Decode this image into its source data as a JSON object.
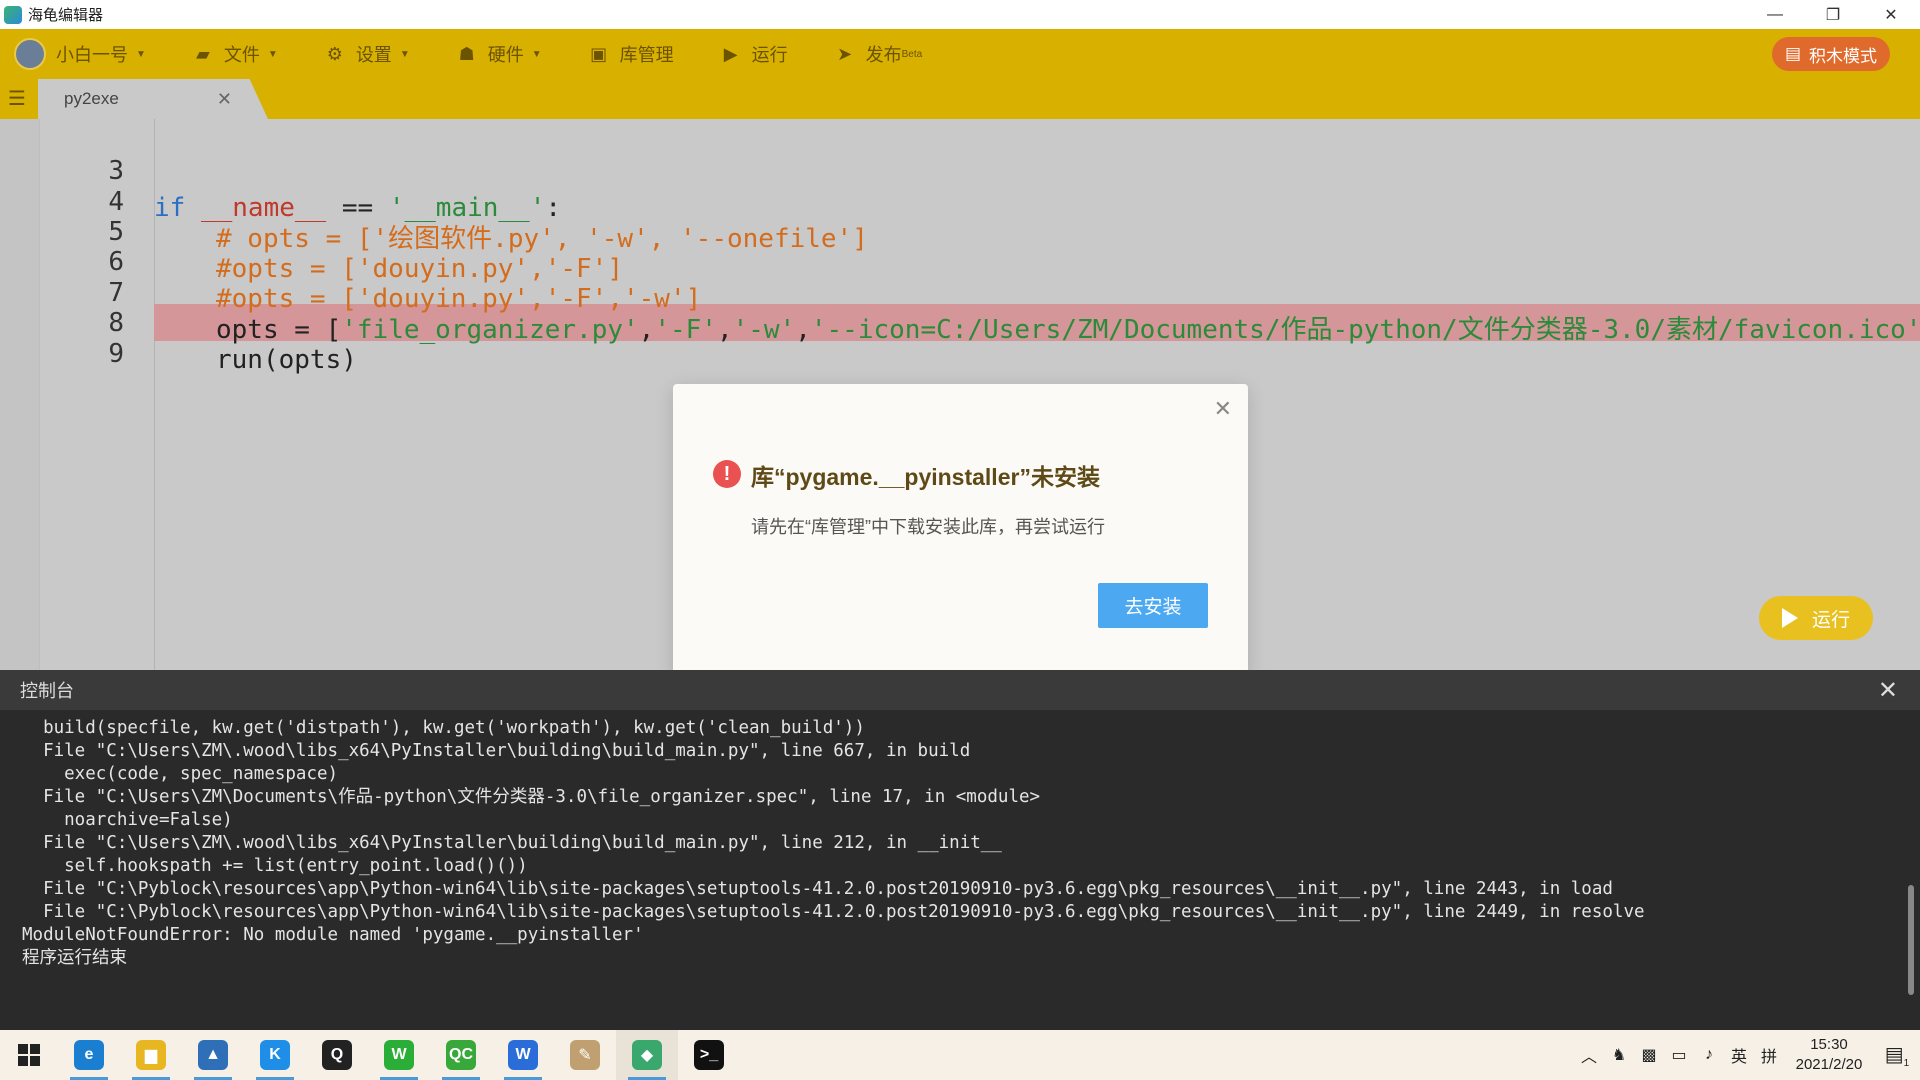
{
  "window": {
    "title": "海龟编辑器"
  },
  "menu": {
    "user": "小白一号",
    "file": "文件",
    "settings": "设置",
    "hardware": "硬件",
    "library": "库管理",
    "run": "运行",
    "publish": "发布",
    "publish_badge": "Beta",
    "block_mode": "积木模式"
  },
  "tab": {
    "name": "py2exe"
  },
  "editor": {
    "lines": [
      {
        "num": "3"
      },
      {
        "num": "4",
        "text": "# opts = ['绘图软件.py', '-w', '--onefile']"
      },
      {
        "num": "5",
        "text": "#opts = ['douyin.py','-F']"
      },
      {
        "num": "6",
        "text": "#opts = ['douyin.py','-F','-w']"
      },
      {
        "num": "7"
      },
      {
        "num": "8",
        "text": "run(opts)"
      },
      {
        "num": "9"
      }
    ],
    "line3": {
      "kw": "if",
      "dunder": "__name__",
      "op": " == ",
      "str": "'__main__'",
      "colon": ":"
    },
    "line7": {
      "prefix": "opts = [",
      "str1": "'file_organizer.py'",
      "sep1": ",",
      "str2": "'-F'",
      "sep2": ",",
      "str3": "'-w'",
      "sep3": ",",
      "str4": "'--icon=C:/Users/ZM/Documents/作品-python/文件分类器-3.0/素材/favicon.ico'",
      "sep4": ",",
      "str5": "'-"
    }
  },
  "dialog": {
    "title": "库“pygame.__pyinstaller”未安装",
    "message": "请先在“库管理”中下载安装此库，再尝试运行",
    "button": "去安装"
  },
  "run_button": "运行",
  "console": {
    "title": "控制台",
    "lines": [
      "  build(specfile, kw.get('distpath'), kw.get('workpath'), kw.get('clean_build'))",
      "  File \"C:\\Users\\ZM\\.wood\\libs_x64\\PyInstaller\\building\\build_main.py\", line 667, in build",
      "    exec(code, spec_namespace)",
      "  File \"C:\\Users\\ZM\\Documents\\作品-python\\文件分类器-3.0\\file_organizer.spec\", line 17, in <module>",
      "    noarchive=False)",
      "  File \"C:\\Users\\ZM\\.wood\\libs_x64\\PyInstaller\\building\\build_main.py\", line 212, in __init__",
      "    self.hookspath += list(entry_point.load()())",
      "  File \"C:\\Pyblock\\resources\\app\\Python-win64\\lib\\site-packages\\setuptools-41.2.0.post20190910-py3.6.egg\\pkg_resources\\__init__.py\", line 2443, in load",
      "  File \"C:\\Pyblock\\resources\\app\\Python-win64\\lib\\site-packages\\setuptools-41.2.0.post20190910-py3.6.egg\\pkg_resources\\__init__.py\", line 2449, in resolve",
      "ModuleNotFoundError: No module named 'pygame.__pyinstaller'",
      "程序运行结束"
    ]
  },
  "taskbar": {
    "apps": [
      {
        "name": "edge-icon",
        "glyph": "e",
        "color": "#1a7fd1"
      },
      {
        "name": "file-explorer-icon",
        "glyph": "▆",
        "color": "#e8b620"
      },
      {
        "name": "photos-icon",
        "glyph": "▲",
        "color": "#2f6fb8"
      },
      {
        "name": "kugou-icon",
        "glyph": "K",
        "color": "#1f8ee8"
      },
      {
        "name": "qq-icon",
        "glyph": "Q",
        "color": "#222222"
      },
      {
        "name": "wechat-icon",
        "glyph": "W",
        "color": "#2aae38"
      },
      {
        "name": "qc-icon",
        "glyph": "QC",
        "color": "#38a83a"
      },
      {
        "name": "wps-icon",
        "glyph": "W",
        "color": "#2b6dd8"
      },
      {
        "name": "paint-icon",
        "glyph": "✎",
        "color": "#c0a070"
      },
      {
        "name": "turtle-editor-icon",
        "glyph": "◆",
        "color": "#3aa86c"
      },
      {
        "name": "terminal-icon",
        "glyph": ">_",
        "color": "#111111"
      }
    ],
    "lang": "英",
    "ime": "拼",
    "time": "15:30",
    "date": "2021/2/20",
    "notification_count": "1"
  },
  "colors": {
    "menu_bg": "#d8b000",
    "highlight_line": "#d49698",
    "keyword": "#2a6fc2",
    "dunder": "#c03a2b",
    "string": "#2c8a3b",
    "comment": "#d46c1d",
    "primary_button": "#4ca8f0",
    "block_mode": "#e06a2c"
  }
}
